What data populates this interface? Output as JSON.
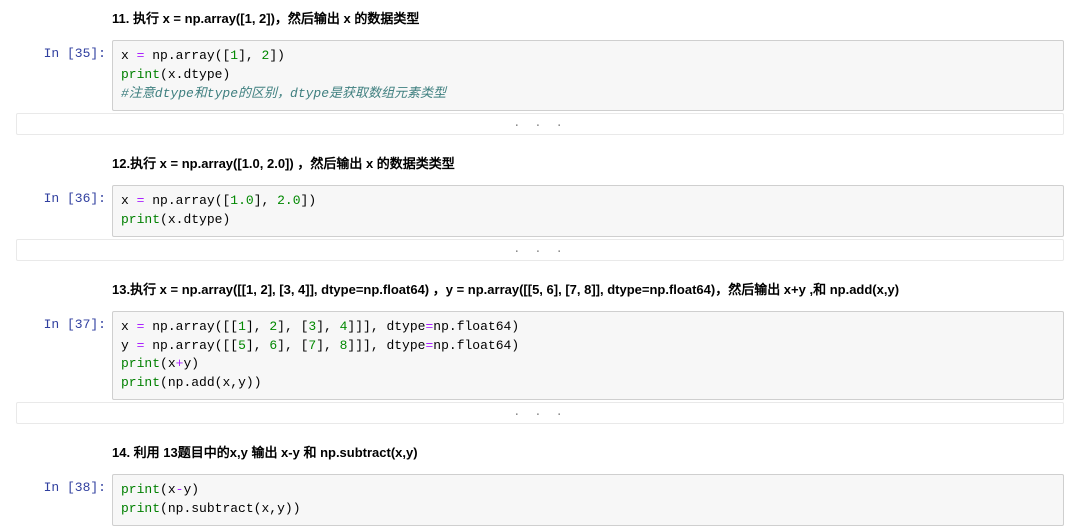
{
  "cells": [
    {
      "type": "heading",
      "text": "11. 执行 x = np.array([1, 2])，然后输出 x 的数据类型"
    },
    {
      "type": "code",
      "prompt_label": "In [35]:",
      "prompt_n": 35,
      "code_lines": [
        [
          [
            "name",
            "x"
          ],
          [
            "sp",
            " "
          ],
          [
            "op",
            "="
          ],
          [
            "sp",
            " "
          ],
          [
            "name",
            "np"
          ],
          [
            "punc",
            "."
          ],
          [
            "name",
            "array"
          ],
          [
            "punc",
            "(["
          ],
          [
            "num",
            "1"
          ],
          [
            "punc",
            "],"
          ],
          [
            "sp",
            " "
          ],
          [
            "num",
            "2"
          ],
          [
            "punc",
            "])"
          ]
        ],
        [
          [
            "bltn",
            "print"
          ],
          [
            "punc",
            "("
          ],
          [
            "name",
            "x"
          ],
          [
            "punc",
            "."
          ],
          [
            "name",
            "dtype"
          ],
          [
            "punc",
            ")"
          ]
        ],
        [
          [
            "cmt",
            "#注意dtype和type的区别，dtype是获取数组元素类型"
          ]
        ]
      ],
      "collapsed_output": true
    },
    {
      "type": "heading",
      "text": "12.执行 x = np.array([1.0, 2.0]) ，然后输出 x 的数据类类型"
    },
    {
      "type": "code",
      "prompt_label": "In [36]:",
      "prompt_n": 36,
      "code_lines": [
        [
          [
            "name",
            "x"
          ],
          [
            "sp",
            " "
          ],
          [
            "op",
            "="
          ],
          [
            "sp",
            " "
          ],
          [
            "name",
            "np"
          ],
          [
            "punc",
            "."
          ],
          [
            "name",
            "array"
          ],
          [
            "punc",
            "(["
          ],
          [
            "num",
            "1.0"
          ],
          [
            "punc",
            "],"
          ],
          [
            "sp",
            " "
          ],
          [
            "num",
            "2.0"
          ],
          [
            "punc",
            "])"
          ]
        ],
        [
          [
            "bltn",
            "print"
          ],
          [
            "punc",
            "("
          ],
          [
            "name",
            "x"
          ],
          [
            "punc",
            "."
          ],
          [
            "name",
            "dtype"
          ],
          [
            "punc",
            ")"
          ]
        ]
      ],
      "collapsed_output": true
    },
    {
      "type": "heading",
      "text": "13.执行 x = np.array([[1, 2], [3, 4]], dtype=np.float64) ，y = np.array([[5, 6], [7, 8]], dtype=np.float64)，然后输出 x+y ,和 np.add(x,y)"
    },
    {
      "type": "code",
      "prompt_label": "In [37]:",
      "prompt_n": 37,
      "code_lines": [
        [
          [
            "name",
            "x"
          ],
          [
            "sp",
            " "
          ],
          [
            "op",
            "="
          ],
          [
            "sp",
            " "
          ],
          [
            "name",
            "np"
          ],
          [
            "punc",
            "."
          ],
          [
            "name",
            "array"
          ],
          [
            "punc",
            "([["
          ],
          [
            "num",
            "1"
          ],
          [
            "punc",
            "],"
          ],
          [
            "sp",
            " "
          ],
          [
            "num",
            "2"
          ],
          [
            "punc",
            "],"
          ],
          [
            "sp",
            " "
          ],
          [
            "punc",
            "["
          ],
          [
            "num",
            "3"
          ],
          [
            "punc",
            "],"
          ],
          [
            "sp",
            " "
          ],
          [
            "num",
            "4"
          ],
          [
            "punc",
            "]]"
          ],
          [
            "punc",
            "],"
          ],
          [
            "sp",
            " "
          ],
          [
            "name",
            "dtype"
          ],
          [
            "op",
            "="
          ],
          [
            "name",
            "np"
          ],
          [
            "punc",
            "."
          ],
          [
            "name",
            "float64"
          ],
          [
            "punc",
            ")"
          ]
        ],
        [
          [
            "name",
            "y"
          ],
          [
            "sp",
            " "
          ],
          [
            "op",
            "="
          ],
          [
            "sp",
            " "
          ],
          [
            "name",
            "np"
          ],
          [
            "punc",
            "."
          ],
          [
            "name",
            "array"
          ],
          [
            "punc",
            "([["
          ],
          [
            "num",
            "5"
          ],
          [
            "punc",
            "],"
          ],
          [
            "sp",
            " "
          ],
          [
            "num",
            "6"
          ],
          [
            "punc",
            "],"
          ],
          [
            "sp",
            " "
          ],
          [
            "punc",
            "["
          ],
          [
            "num",
            "7"
          ],
          [
            "punc",
            "],"
          ],
          [
            "sp",
            " "
          ],
          [
            "num",
            "8"
          ],
          [
            "punc",
            "]]"
          ],
          [
            "punc",
            "],"
          ],
          [
            "sp",
            " "
          ],
          [
            "name",
            "dtype"
          ],
          [
            "op",
            "="
          ],
          [
            "name",
            "np"
          ],
          [
            "punc",
            "."
          ],
          [
            "name",
            "float64"
          ],
          [
            "punc",
            ")"
          ]
        ],
        [
          [
            "bltn",
            "print"
          ],
          [
            "punc",
            "("
          ],
          [
            "name",
            "x"
          ],
          [
            "op",
            "+"
          ],
          [
            "name",
            "y"
          ],
          [
            "punc",
            ")"
          ]
        ],
        [
          [
            "bltn",
            "print"
          ],
          [
            "punc",
            "("
          ],
          [
            "name",
            "np"
          ],
          [
            "punc",
            "."
          ],
          [
            "name",
            "add"
          ],
          [
            "punc",
            "("
          ],
          [
            "name",
            "x"
          ],
          [
            "punc",
            ","
          ],
          [
            "name",
            "y"
          ],
          [
            "punc",
            "))"
          ]
        ]
      ],
      "collapsed_output": true
    },
    {
      "type": "heading",
      "text": "14. 利用 13题目中的x,y 输出 x-y 和 np.subtract(x,y)"
    },
    {
      "type": "code",
      "prompt_label": "In [38]:",
      "prompt_n": 38,
      "code_lines": [
        [
          [
            "bltn",
            "print"
          ],
          [
            "punc",
            "("
          ],
          [
            "name",
            "x"
          ],
          [
            "op",
            "-"
          ],
          [
            "name",
            "y"
          ],
          [
            "punc",
            ")"
          ]
        ],
        [
          [
            "bltn",
            "print"
          ],
          [
            "punc",
            "("
          ],
          [
            "name",
            "np"
          ],
          [
            "punc",
            "."
          ],
          [
            "name",
            "subtract"
          ],
          [
            "punc",
            "("
          ],
          [
            "name",
            "x"
          ],
          [
            "punc",
            ","
          ],
          [
            "name",
            "y"
          ],
          [
            "punc",
            "))"
          ]
        ]
      ],
      "collapsed_output": false
    }
  ],
  "ellipsis": ". . ."
}
